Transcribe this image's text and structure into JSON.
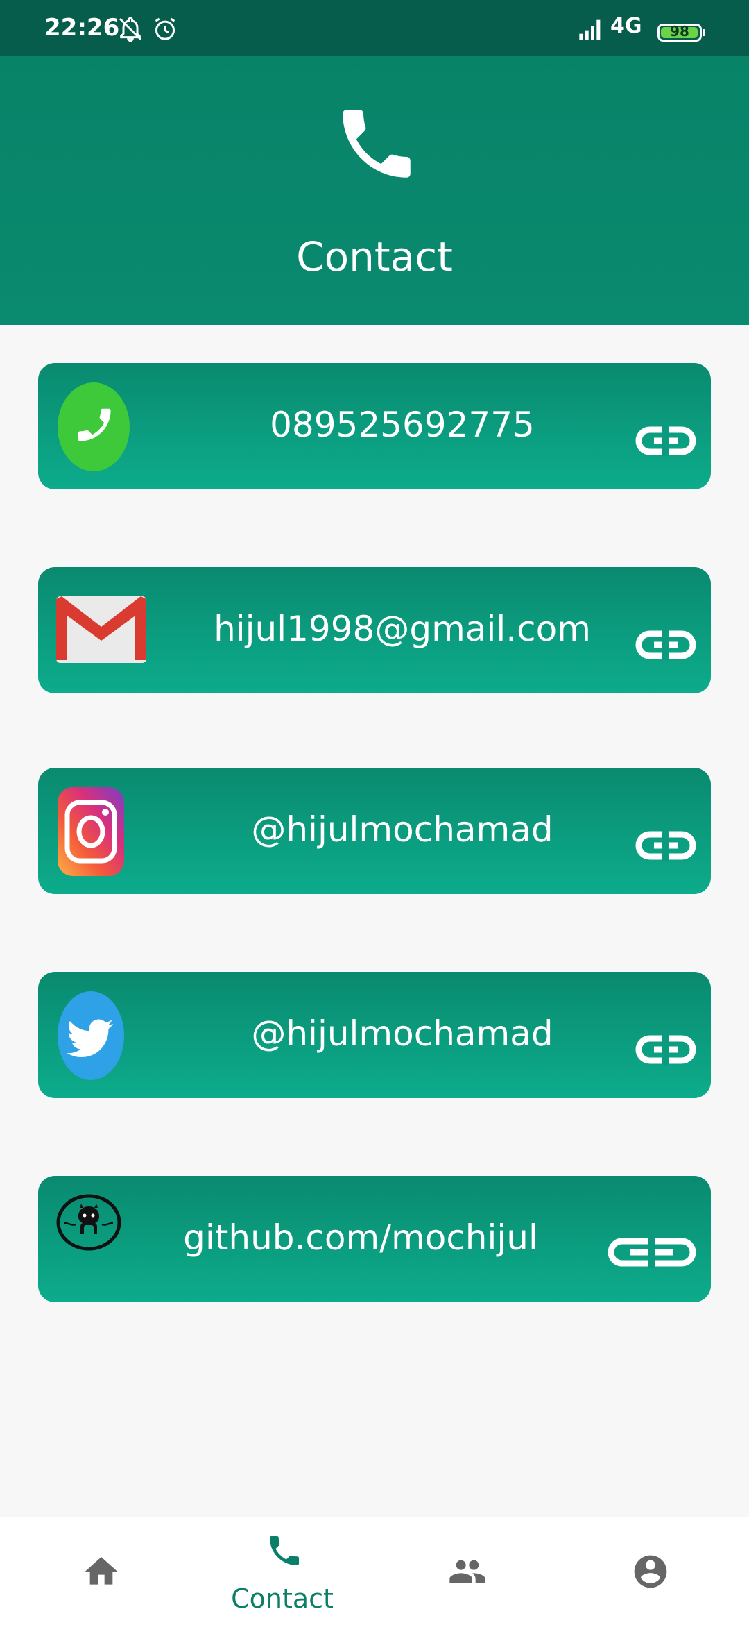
{
  "status_bar": {
    "time": "22:26",
    "network": "4G",
    "battery": "98",
    "battery_level": 0.98
  },
  "header": {
    "title": "Contact",
    "icon": "phone-icon"
  },
  "contacts": [
    {
      "label": "089525692775",
      "icon": "phone-green-icon"
    },
    {
      "label": "hijul1998@gmail.com",
      "icon": "gmail-icon"
    },
    {
      "label": "@hijulmochamad",
      "icon": "instagram-icon"
    },
    {
      "label": "@hijulmochamad",
      "icon": "twitter-icon"
    },
    {
      "label": "github.com/mochijul",
      "icon": "github-icon"
    }
  ],
  "bottom_nav": {
    "items": [
      {
        "icon": "home-icon",
        "label": ""
      },
      {
        "icon": "phone-icon",
        "label": "Contact",
        "active": true
      },
      {
        "icon": "people-icon",
        "label": ""
      },
      {
        "icon": "account-icon",
        "label": ""
      }
    ]
  },
  "colors": {
    "primary": "#088368",
    "card_gradient_end": "#0cac8c",
    "status_bar": "#075d4b",
    "active_nav": "#0a7f68",
    "inactive_nav": "#666666"
  }
}
